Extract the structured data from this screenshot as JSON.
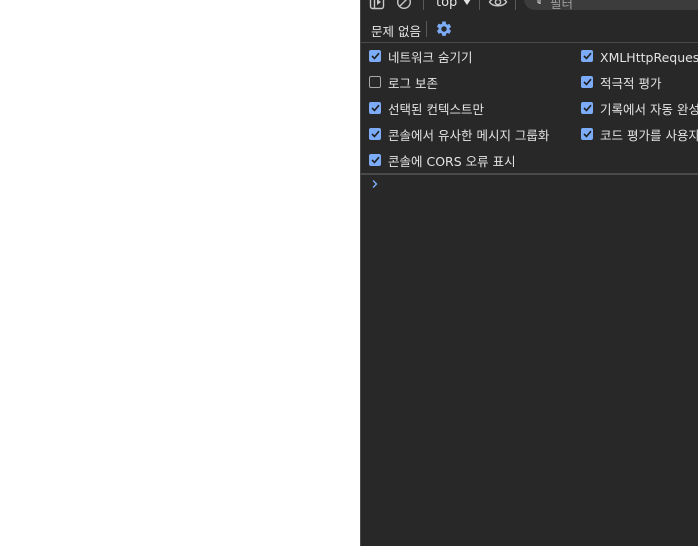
{
  "toolbar": {
    "context": "top",
    "filter_placeholder": "필터",
    "icons": [
      "sidebar-toggle-icon",
      "clear-console-icon",
      "eye-icon",
      "filter-icon"
    ]
  },
  "issues": {
    "label": "문제 없음",
    "settings_icon": "gear-icon"
  },
  "settings": {
    "left": [
      {
        "label": "네트워크 숨기기",
        "checked": true
      },
      {
        "label": "로그 보존",
        "checked": false
      },
      {
        "label": "선택된 컨텍스트만",
        "checked": true
      },
      {
        "label": "콘솔에서 유사한 메시지 그룹화",
        "checked": true
      },
      {
        "label": "콘솔에 CORS 오류 표시",
        "checked": true
      }
    ],
    "right": [
      {
        "label": "XMLHttpRequest 로깅",
        "checked": true
      },
      {
        "label": "적극적 평가",
        "checked": true
      },
      {
        "label": "기록에서 자동 완성",
        "checked": true
      },
      {
        "label": "코드 평가를 사용자 작업으로 처리",
        "checked": true
      }
    ]
  },
  "colors": {
    "panel_bg": "#282828",
    "accent": "#7cacf8",
    "text": "#e3e3e3"
  }
}
